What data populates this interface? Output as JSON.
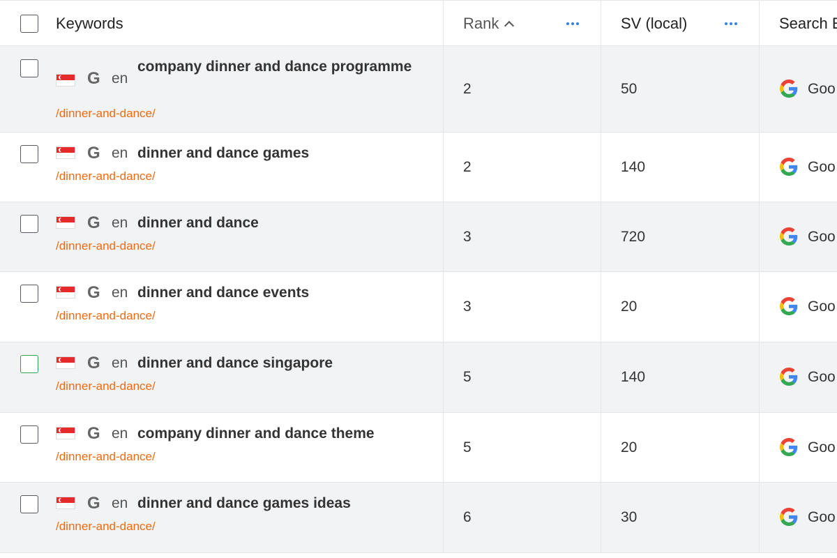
{
  "header": {
    "keywords_label": "Keywords",
    "rank_label": "Rank",
    "sv_label": "SV (local)",
    "search_engine_label": "Search E"
  },
  "colors": {
    "url": "#ef6a12",
    "menu_dots": "#2f80ed",
    "alt_row": "#f2f3f5",
    "checkbox_focus": "#2ea44f"
  },
  "icons": {
    "flag": "singapore-flag-icon",
    "engine": "google-g-icon",
    "sort": "chevron-up-icon",
    "menu": "more-horizontal-icon"
  },
  "rows": [
    {
      "flag_g": "G",
      "lang": "en",
      "keyword": "company dinner and dance programme",
      "url": "/dinner-and-dance/",
      "rank": "2",
      "sv": "50",
      "engine": "Goo"
    },
    {
      "flag_g": "G",
      "lang": "en",
      "keyword": "dinner and dance games",
      "url": "/dinner-and-dance/",
      "rank": "2",
      "sv": "140",
      "engine": "Goo"
    },
    {
      "flag_g": "G",
      "lang": "en",
      "keyword": "dinner and dance",
      "url": "/dinner-and-dance/",
      "rank": "3",
      "sv": "720",
      "engine": "Goo"
    },
    {
      "flag_g": "G",
      "lang": "en",
      "keyword": "dinner and dance events",
      "url": "/dinner-and-dance/",
      "rank": "3",
      "sv": "20",
      "engine": "Goo"
    },
    {
      "flag_g": "G",
      "lang": "en",
      "keyword": "dinner and dance singapore",
      "url": "/dinner-and-dance/",
      "rank": "5",
      "sv": "140",
      "engine": "Goo"
    },
    {
      "flag_g": "G",
      "lang": "en",
      "keyword": "company dinner and dance theme",
      "url": "/dinner-and-dance/",
      "rank": "5",
      "sv": "20",
      "engine": "Goo"
    },
    {
      "flag_g": "G",
      "lang": "en",
      "keyword": "dinner and dance games ideas",
      "url": "/dinner-and-dance/",
      "rank": "6",
      "sv": "30",
      "engine": "Goo"
    }
  ]
}
